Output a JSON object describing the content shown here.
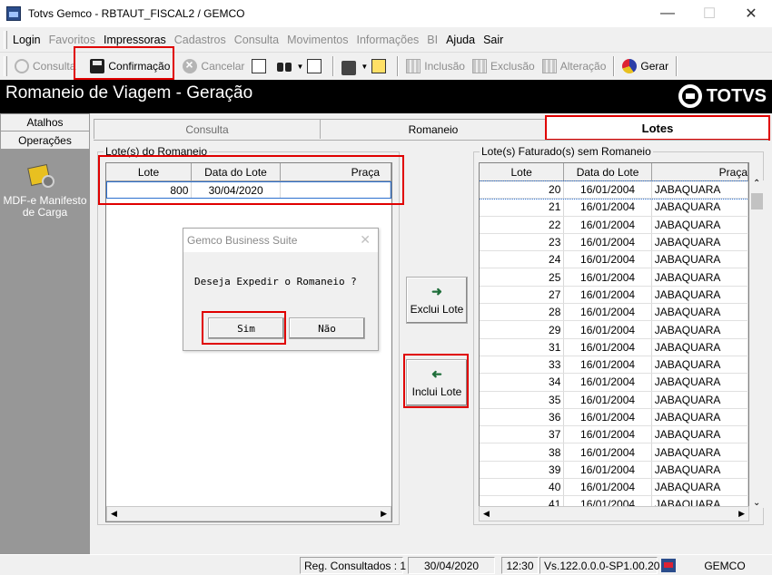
{
  "window": {
    "title": "Totvs Gemco - RBTAUT_FISCAL2 / GEMCO"
  },
  "menu": [
    {
      "label": "Login",
      "enabled": true
    },
    {
      "label": "Favoritos",
      "enabled": false
    },
    {
      "label": "Impressoras",
      "enabled": true
    },
    {
      "label": "Cadastros",
      "enabled": false
    },
    {
      "label": "Consulta",
      "enabled": false
    },
    {
      "label": "Movimentos",
      "enabled": false
    },
    {
      "label": "Informações",
      "enabled": false
    },
    {
      "label": "BI",
      "enabled": false
    },
    {
      "label": "Ajuda",
      "enabled": true
    },
    {
      "label": "Sair",
      "enabled": true
    }
  ],
  "toolbar": {
    "consulta": "Consulta",
    "confirmacao": "Confirmação",
    "cancelar": "Cancelar",
    "inclusao": "Inclusão",
    "exclusao": "Exclusão",
    "alteracao": "Alteração",
    "gerar": "Gerar"
  },
  "header": {
    "title": "Romaneio de Viagem  - Geração",
    "logo": "TOTVS"
  },
  "leftnav": {
    "tab1": "Atalhos",
    "tab2": "Operações",
    "item_label": "MDF-e Manifesto de Carga"
  },
  "tabs": {
    "consulta": "Consulta",
    "romaneio": "Romaneio",
    "lotes": "Lotes"
  },
  "left_group": {
    "legend": "Lote(s) do Romaneio",
    "columns": [
      "Lote",
      "Data do Lote",
      "Praça"
    ],
    "rows": [
      {
        "lote": "800",
        "data": "30/04/2020",
        "praca": ""
      }
    ]
  },
  "right_group": {
    "legend": "Lote(s) Faturado(s) sem Romaneio",
    "columns": [
      "Lote",
      "Data do Lote",
      "Praça"
    ],
    "rows": [
      {
        "lote": "20",
        "data": "16/01/2004",
        "praca": "JABAQUARA"
      },
      {
        "lote": "21",
        "data": "16/01/2004",
        "praca": "JABAQUARA"
      },
      {
        "lote": "22",
        "data": "16/01/2004",
        "praca": "JABAQUARA"
      },
      {
        "lote": "23",
        "data": "16/01/2004",
        "praca": "JABAQUARA"
      },
      {
        "lote": "24",
        "data": "16/01/2004",
        "praca": "JABAQUARA"
      },
      {
        "lote": "25",
        "data": "16/01/2004",
        "praca": "JABAQUARA"
      },
      {
        "lote": "27",
        "data": "16/01/2004",
        "praca": "JABAQUARA"
      },
      {
        "lote": "28",
        "data": "16/01/2004",
        "praca": "JABAQUARA"
      },
      {
        "lote": "29",
        "data": "16/01/2004",
        "praca": "JABAQUARA"
      },
      {
        "lote": "31",
        "data": "16/01/2004",
        "praca": "JABAQUARA"
      },
      {
        "lote": "33",
        "data": "16/01/2004",
        "praca": "JABAQUARA"
      },
      {
        "lote": "34",
        "data": "16/01/2004",
        "praca": "JABAQUARA"
      },
      {
        "lote": "35",
        "data": "16/01/2004",
        "praca": "JABAQUARA"
      },
      {
        "lote": "36",
        "data": "16/01/2004",
        "praca": "JABAQUARA"
      },
      {
        "lote": "37",
        "data": "16/01/2004",
        "praca": "JABAQUARA"
      },
      {
        "lote": "38",
        "data": "16/01/2004",
        "praca": "JABAQUARA"
      },
      {
        "lote": "39",
        "data": "16/01/2004",
        "praca": "JABAQUARA"
      },
      {
        "lote": "40",
        "data": "16/01/2004",
        "praca": "JABAQUARA"
      },
      {
        "lote": "41",
        "data": "16/01/2004",
        "praca": "JABAQUARA"
      }
    ]
  },
  "buttons": {
    "exclui": "Exclui Lote",
    "inclui": "Inclui Lote"
  },
  "dialog": {
    "title": "Gemco Business Suite",
    "message": "Deseja Expedir o Romaneio ?",
    "yes": "Sim",
    "no": "Não"
  },
  "statusbar": {
    "reg": "Reg. Consultados : 1",
    "date": "30/04/2020",
    "time": "12:30",
    "version": "Vs.122.0.0.0-SP1.00.20",
    "company": "GEMCO"
  },
  "colors": {
    "highlight": "#e00000",
    "header_bg": "#000000",
    "nav_bg": "#979797"
  }
}
